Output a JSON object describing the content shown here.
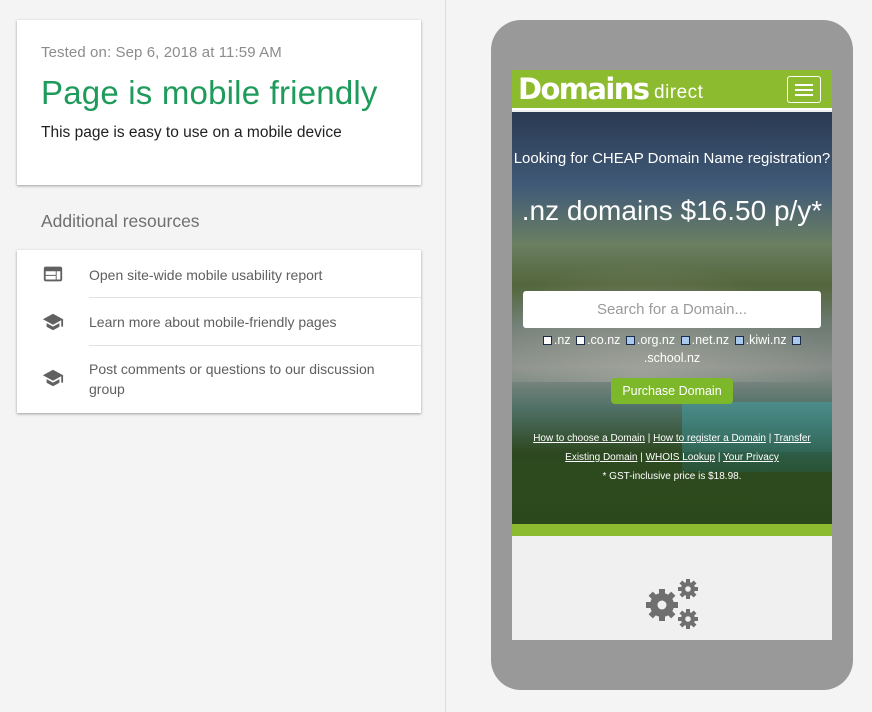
{
  "result": {
    "tested_on": "Tested on: Sep 6, 2018 at 11:59 AM",
    "headline": "Page is mobile friendly",
    "subline": "This page is easy to use on a mobile device"
  },
  "resources": {
    "title": "Additional resources",
    "items": [
      {
        "icon": "web-icon",
        "label": "Open site-wide mobile usability report"
      },
      {
        "icon": "school-icon",
        "label": "Learn more about mobile-friendly pages"
      },
      {
        "icon": "school-icon",
        "label": "Post comments or questions to our discussion group"
      }
    ]
  },
  "phone": {
    "logo_main": "Domains",
    "logo_sub": "direct",
    "hero_question": "Looking for CHEAP Domain Name registration?",
    "hero_price": ".nz domains $16.50 p/y*",
    "search_placeholder": "Search for a Domain...",
    "tlds": [
      ".nz",
      ".co.nz",
      ".org.nz",
      ".net.nz",
      ".kiwi.nz",
      ".school.nz"
    ],
    "purchase_label": "Purchase Domain",
    "links": [
      "How to choose a Domain",
      "How to register a Domain",
      "Transfer Existing Domain",
      "WHOIS Lookup",
      "Your Privacy"
    ],
    "gst_note": "* GST-inclusive price is $18.98."
  },
  "colors": {
    "mobile_friendly_green": "#1e9b5a",
    "site_green": "#8dbb2f",
    "button_green": "#7cb82a",
    "phone_frame": "#999999"
  }
}
